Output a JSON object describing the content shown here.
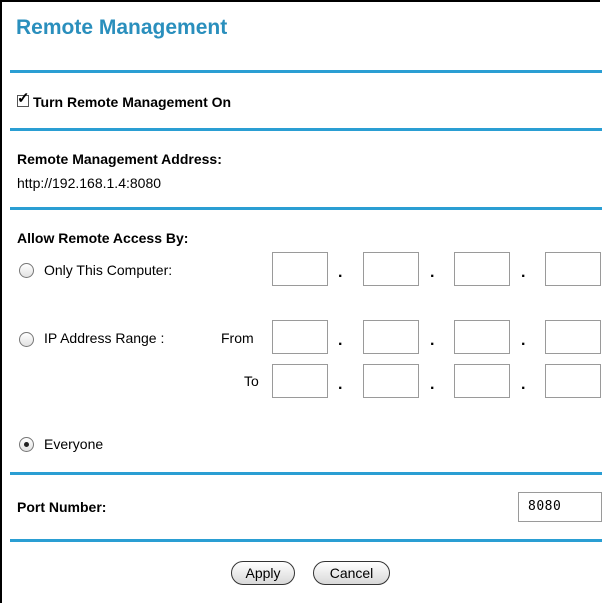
{
  "page": {
    "title": "Remote Management"
  },
  "remote_on": {
    "label": "Turn Remote Management On",
    "checked": true
  },
  "address": {
    "label": "Remote Management Address:",
    "value": "http://192.168.1.4:8080"
  },
  "access": {
    "label": "Allow Remote Access By:",
    "only_this_computer": {
      "label": "Only This Computer:",
      "selected": false,
      "octets": [
        "",
        "",
        "",
        ""
      ]
    },
    "ip_range": {
      "label": "IP Address Range :",
      "selected": false,
      "from_label": "From",
      "to_label": "To",
      "from_octets": [
        "",
        "",
        "",
        ""
      ],
      "to_octets": [
        "",
        "",
        "",
        ""
      ]
    },
    "everyone": {
      "label": "Everyone",
      "selected": true
    },
    "separator": "."
  },
  "port": {
    "label": "Port Number:",
    "value": "8080"
  },
  "buttons": {
    "apply": "Apply",
    "cancel": "Cancel"
  },
  "colors": {
    "title": "#2a8fbd",
    "rule": "#2a9ed3"
  }
}
